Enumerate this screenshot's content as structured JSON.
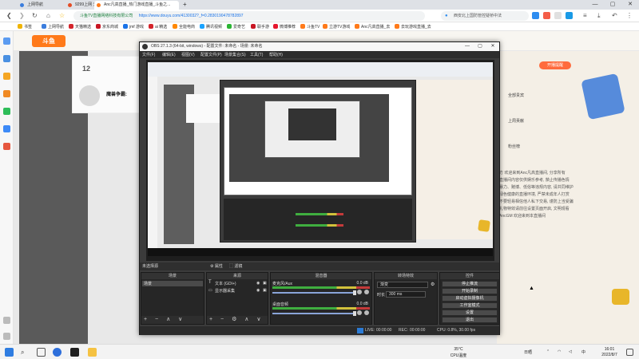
{
  "browser": {
    "tabs": [
      {
        "label": "上网导航",
        "active": false,
        "color": "#3b7ddd"
      },
      {
        "label": "9299上网 天猫精选",
        "active": false,
        "color": "#e44d26"
      },
      {
        "label": "Anc凡高直播_热门游戏直播_斗鱼之...",
        "active": true,
        "color": "#ff7a1a"
      }
    ],
    "new_tab": "+",
    "window_buttons": [
      "—",
      "▢",
      "✕"
    ],
    "url_secure": "斗鱼TV直播网络科技有限公司",
    "url": "https://www.douyu.com/4130032?_f=0.2830190478782897",
    "search_text": "西安北上国防管控疑桥中法",
    "bookmarks": [
      {
        "label": "书签",
        "color": "#f0b400"
      },
      {
        "label": "上网导航",
        "color": "#3b7ddd"
      },
      {
        "label": "天猫精选",
        "color": "#d4242b"
      },
      {
        "label": "京东商城",
        "color": "#c81623"
      },
      {
        "label": "jmf 游戏",
        "color": "#1a73e8"
      },
      {
        "label": "ai 精选",
        "color": "#d4242b"
      },
      {
        "label": "全能电商",
        "color": "#ff8800"
      },
      {
        "label": "腾讯视频",
        "color": "#1aa3ff"
      },
      {
        "label": "爱奇艺",
        "color": "#2cb534"
      },
      {
        "label": "联手游",
        "color": "#c81623"
      },
      {
        "label": "微博推荐",
        "color": "#e6162d"
      },
      {
        "label": "斗鱼TV",
        "color": "#ff7a1a"
      },
      {
        "label": "立游TV游戏",
        "color": "#ff7a1a"
      },
      {
        "label": "Anc凡高直播_去",
        "color": "#ff7a1a"
      },
      {
        "label": "去玩游戏直播_去",
        "color": "#ff7a1a"
      }
    ]
  },
  "douyu": {
    "logo": "斗鱼",
    "anchor_number": "12",
    "anchor_name": "魔兽争霸:",
    "gift_button": "开播提醒",
    "right_lines": [
      "全部贵宾",
      "上周贡献",
      "粉丝榜"
    ],
    "chat_lines": [
      "方 欢迎来到Anc凡高直播间, 分享所有",
      "直播间内容仅供娱乐参考, 禁止传播色情",
      "暴力、赌博、低俗等违规内容, 请共同维护",
      "绿色健康的直播环境, 严禁未成年人打赏",
      "不要轻易相信他人私下交易, 谨防上当受骗",
      "礼物特效请前往设置页面开启, 文明观看",
      "AncGM 欢迎来到本直播间"
    ]
  },
  "obs": {
    "title": "OBS 27.1.3 (64-bit, windows) - 配置文件: 未命名 - 场景: 未命名",
    "window_buttons": [
      "—",
      "▢",
      "✕"
    ],
    "menu": [
      "文件(F)",
      "编辑(E)",
      "视图(V)",
      "配置文件(P)",
      "场景集合(S)",
      "工具(T)",
      "帮助(H)"
    ],
    "docks_header": [
      "未选择源",
      "⚙ 属性",
      "⬚ 滤镜"
    ],
    "scenes": {
      "title": "场景",
      "items": [
        "场景"
      ],
      "toolbar": "+ − ∧ ∨"
    },
    "sources": {
      "title": "来源",
      "items": [
        "文本 (GDI+)",
        "显示器采集"
      ],
      "toolbar": "+ − ⚙ ∧ ∨"
    },
    "mixer": {
      "title": "混音器",
      "channels": [
        {
          "name": "麦克风/Aux",
          "db": "0.0 dB"
        },
        {
          "name": "桌面音频",
          "db": "0.0 dB"
        }
      ]
    },
    "transitions": {
      "title": "转场特效",
      "type_label": "渐变",
      "duration_label": "时长",
      "duration": "300 ms"
    },
    "controls": {
      "title": "控件",
      "buttons": [
        "停止推流",
        "开始录制",
        "启动虚拟摄像机",
        "工作室模式",
        "设置",
        "退出"
      ]
    },
    "status": {
      "live_label": "LIVE:",
      "live_time": "00:00:00",
      "rec_label": "REC:",
      "rec_time": "00:00:00",
      "cpu": "CPU: 0.8%, 30.00 fps"
    }
  },
  "taskbar": {
    "weather_temp": "35°C",
    "weather_desc": "CPU温度",
    "tray_text": "日晒",
    "time": "16:01",
    "date": "2022/8/7"
  }
}
